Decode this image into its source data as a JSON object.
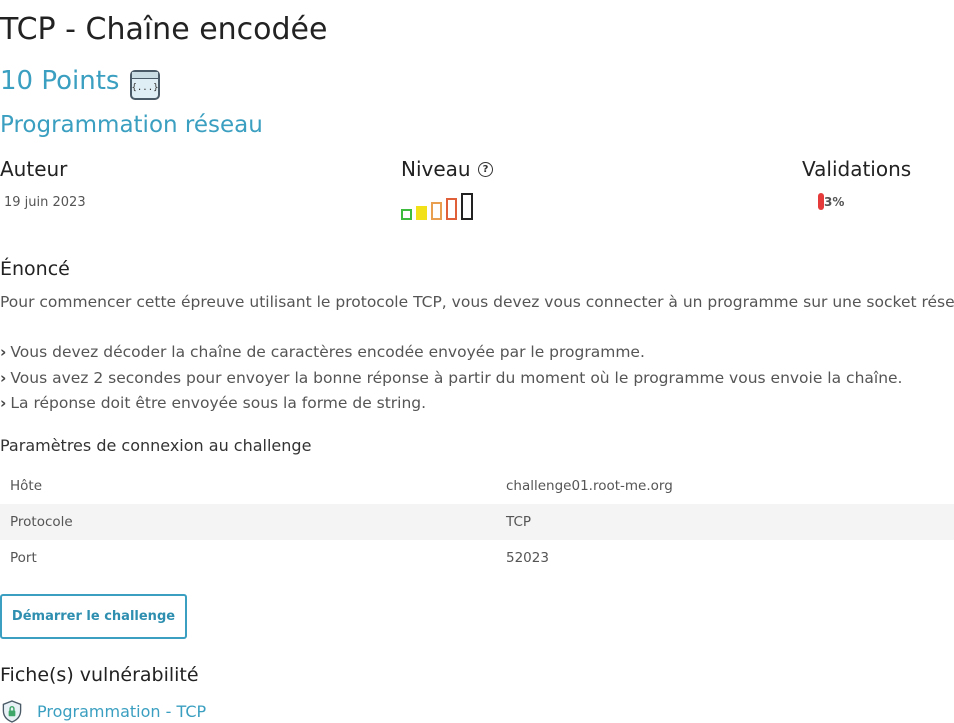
{
  "challenge": {
    "title": "TCP - Chaîne encodée",
    "points": "10 Points",
    "category": "Programmation réseau",
    "icon": "code-window-icon",
    "icon_glyph": "{...}"
  },
  "info": {
    "author_label": "Auteur",
    "date": "19 juin 2023",
    "level_label": "Niveau",
    "level_help_icon": "question-circle-icon",
    "level_help_glyph": "?",
    "levels": [
      {
        "color": "#3dbb3d",
        "filled": false
      },
      {
        "color": "#f2e018",
        "filled": true
      },
      {
        "color": "#e8a050",
        "filled": false
      },
      {
        "color": "#e0603a",
        "filled": false
      },
      {
        "color": "#222222",
        "filled": false
      }
    ],
    "validations_label": "Validations",
    "validations_pct": "3%",
    "validations_fraction": 0.03,
    "validations_color": "#e53b3b"
  },
  "statement": {
    "title": "Énoncé",
    "intro": "Pour commencer cette épreuve utilisant le protocole TCP, vous devez vous connecter à un programme sur une socket réseau.",
    "bullet_glyph": "›",
    "bullets": [
      "Vous devez décoder la chaîne de caractères encodée envoyée par le programme.",
      "Vous avez 2 secondes pour envoyer la bonne réponse à partir du moment où le programme vous envoie la chaîne.",
      "La réponse doit être envoyée sous la forme de string."
    ]
  },
  "connection": {
    "title": "Paramètres de connexion au challenge",
    "rows": [
      {
        "key": "Hôte",
        "value": "challenge01.root-me.org"
      },
      {
        "key": "Protocole",
        "value": "TCP"
      },
      {
        "key": "Port",
        "value": "52023"
      }
    ],
    "start_button": "Démarrer le challenge"
  },
  "vulnerability": {
    "title": "Fiche(s) vulnérabilité",
    "icon": "shield-lock-icon",
    "link": "Programmation - TCP"
  }
}
